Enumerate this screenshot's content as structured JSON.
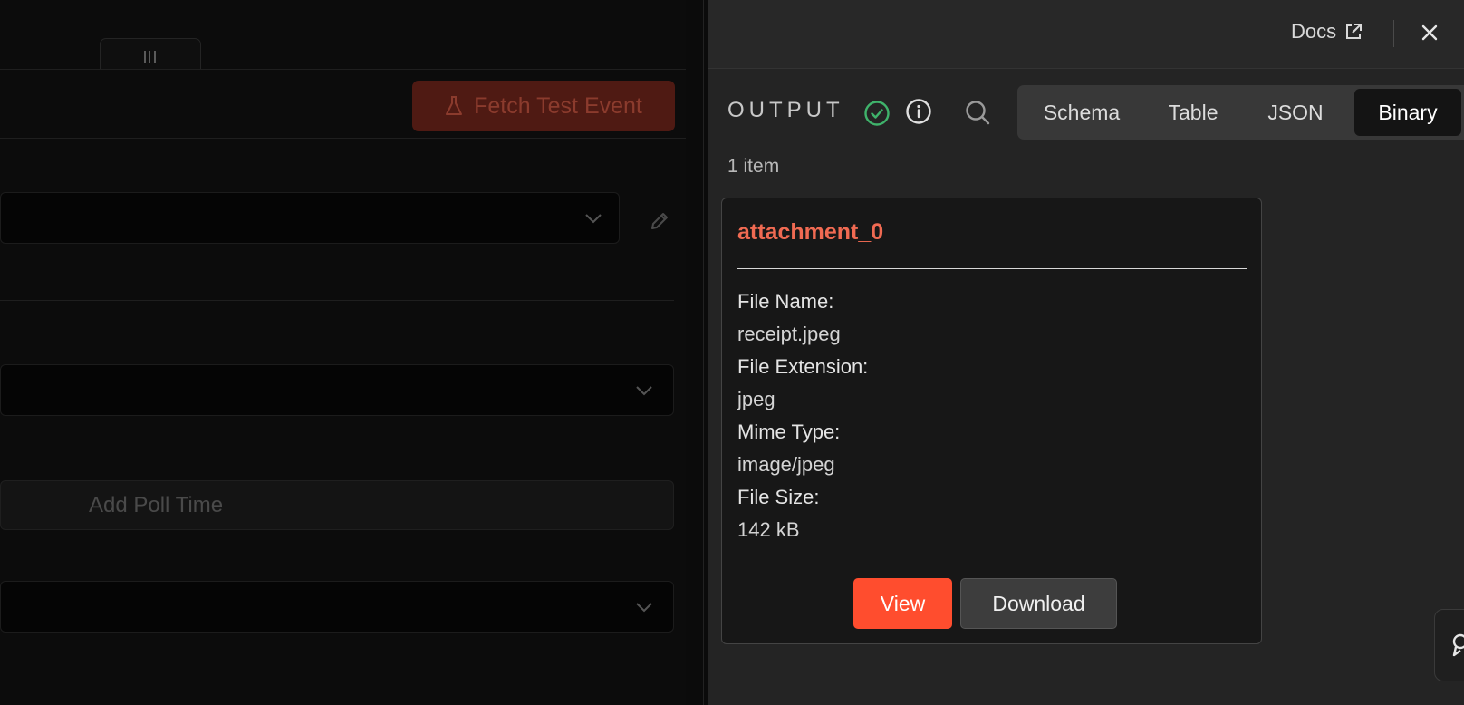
{
  "editor": {
    "fetch_button_label": "Fetch Test Event",
    "add_poll_time_label": "Add Poll Time"
  },
  "header": {
    "docs_label": "Docs"
  },
  "output": {
    "label": "OUTPUT",
    "tabs": [
      "Schema",
      "Table",
      "JSON",
      "Binary"
    ],
    "active_tab": "Binary",
    "item_count": "1 item",
    "card": {
      "title": "attachment_0",
      "fields": [
        {
          "key": "File Name:",
          "value": "receipt.jpeg"
        },
        {
          "key": "File Extension:",
          "value": "jpeg"
        },
        {
          "key": "Mime Type:",
          "value": "image/jpeg"
        },
        {
          "key": "File Size:",
          "value": "142 kB"
        }
      ],
      "view_label": "View",
      "download_label": "Download"
    }
  },
  "colors": {
    "accent": "#ff4d2e",
    "title": "#f06a52",
    "success": "#3fb36b",
    "panel": "#242424"
  }
}
